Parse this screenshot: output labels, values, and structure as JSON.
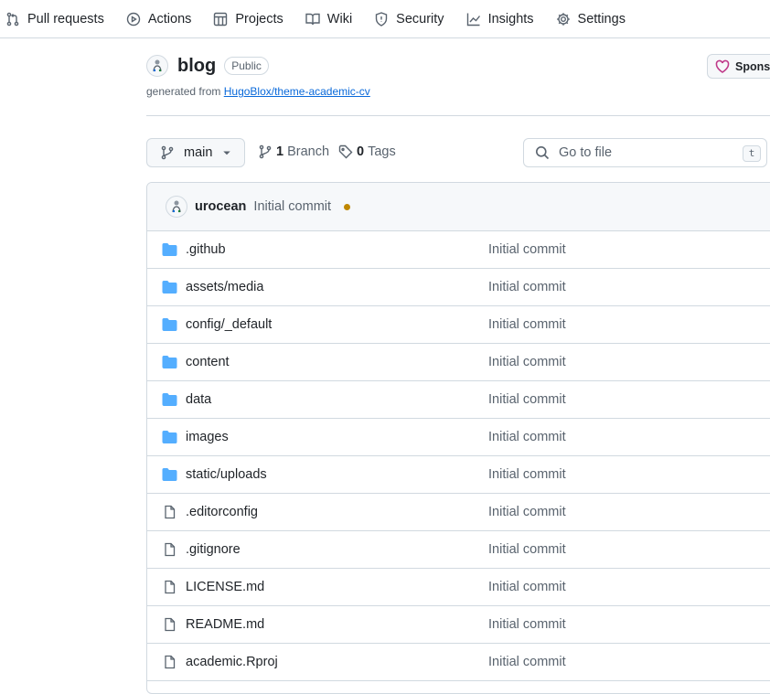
{
  "nav": {
    "items": [
      {
        "label": "Pull requests",
        "icon": "pull-request-icon"
      },
      {
        "label": "Actions",
        "icon": "play-icon"
      },
      {
        "label": "Projects",
        "icon": "table-icon"
      },
      {
        "label": "Wiki",
        "icon": "book-icon"
      },
      {
        "label": "Security",
        "icon": "shield-icon"
      },
      {
        "label": "Insights",
        "icon": "graph-icon"
      },
      {
        "label": "Settings",
        "icon": "gear-icon"
      }
    ]
  },
  "repo": {
    "name": "blog",
    "visibility": "Public",
    "generated_prefix": "generated from",
    "generated_link": "HugoBlox/theme-academic-cv",
    "sponsor_label": "Sponsor"
  },
  "toolbar": {
    "branch": "main",
    "branch_count": "1",
    "branch_label": "Branch",
    "tag_count": "0",
    "tag_label": "Tags",
    "search_placeholder": "Go to file",
    "search_shortcut": "t"
  },
  "latest_commit": {
    "user": "urocean",
    "message": "Initial commit",
    "status_color": "#bf8700"
  },
  "files": [
    {
      "name": ".github",
      "type": "folder",
      "commit": "Initial commit"
    },
    {
      "name": "assets/media",
      "type": "folder",
      "commit": "Initial commit"
    },
    {
      "name": "config/_default",
      "type": "folder",
      "commit": "Initial commit"
    },
    {
      "name": "content",
      "type": "folder",
      "commit": "Initial commit"
    },
    {
      "name": "data",
      "type": "folder",
      "commit": "Initial commit"
    },
    {
      "name": "images",
      "type": "folder",
      "commit": "Initial commit"
    },
    {
      "name": "static/uploads",
      "type": "folder",
      "commit": "Initial commit"
    },
    {
      "name": ".editorconfig",
      "type": "file",
      "commit": "Initial commit"
    },
    {
      "name": ".gitignore",
      "type": "file",
      "commit": "Initial commit"
    },
    {
      "name": "LICENSE.md",
      "type": "file",
      "commit": "Initial commit"
    },
    {
      "name": "README.md",
      "type": "file",
      "commit": "Initial commit"
    },
    {
      "name": "academic.Rproj",
      "type": "file",
      "commit": "Initial commit"
    }
  ],
  "colors": {
    "folder": "#54aeff",
    "link": "#0969da",
    "border": "#d1d9e0"
  }
}
